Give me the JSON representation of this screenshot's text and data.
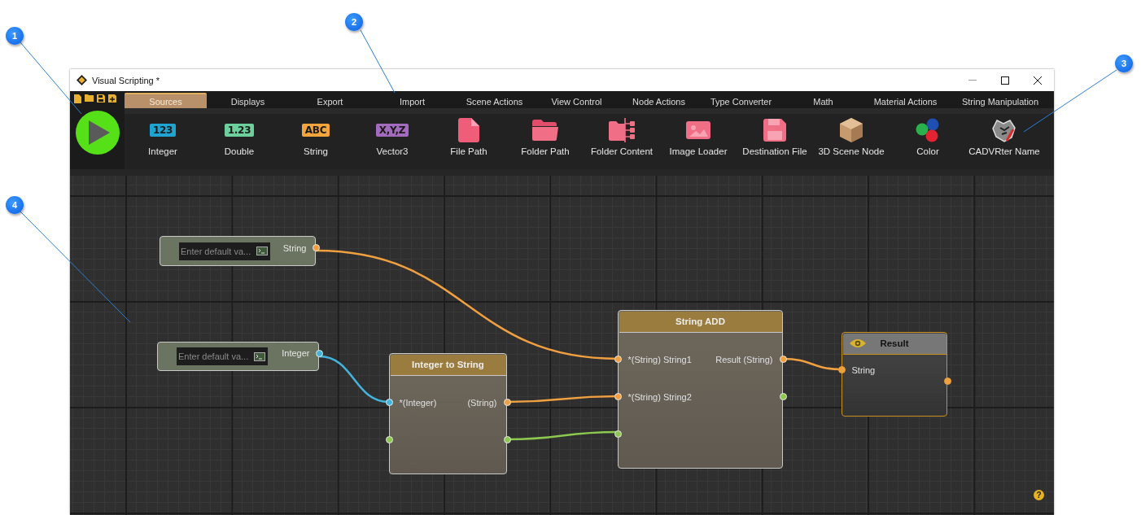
{
  "window": {
    "title": "Visual Scripting *"
  },
  "callouts": [
    {
      "label": "1"
    },
    {
      "label": "2"
    },
    {
      "label": "3"
    },
    {
      "label": "4"
    }
  ],
  "tabs": [
    {
      "label": "Sources",
      "selected": true
    },
    {
      "label": "Displays",
      "selected": false
    },
    {
      "label": "Export",
      "selected": false
    },
    {
      "label": "Import",
      "selected": false
    },
    {
      "label": "Scene Actions",
      "selected": false
    },
    {
      "label": "View Control",
      "selected": false
    },
    {
      "label": "Node Actions",
      "selected": false
    },
    {
      "label": "Type Converter",
      "selected": false
    },
    {
      "label": "Math",
      "selected": false
    },
    {
      "label": "Material Actions",
      "selected": false
    },
    {
      "label": "String Manipulation",
      "selected": false
    }
  ],
  "palette": [
    {
      "kind": "badge",
      "badge": "123",
      "color": "#1fa3d1",
      "label": "Integer"
    },
    {
      "kind": "badge",
      "badge": "1.23",
      "color": "#6ccf9c",
      "label": "Double"
    },
    {
      "kind": "badge",
      "badge": "ABC",
      "color": "#f3a43b",
      "label": "String"
    },
    {
      "kind": "badge",
      "badge": "X,Y,Z",
      "color": "#a26bbd",
      "label": "Vector3"
    },
    {
      "kind": "file",
      "label": "File Path"
    },
    {
      "kind": "folder",
      "label": "Folder Path"
    },
    {
      "kind": "folder-content",
      "label": "Folder Content"
    },
    {
      "kind": "image",
      "label": "Image Loader"
    },
    {
      "kind": "floppy",
      "label": "Destination File"
    },
    {
      "kind": "cube",
      "label": "3D Scene Node"
    },
    {
      "kind": "color",
      "label": "Color"
    },
    {
      "kind": "logo",
      "label": "CADVRter Name"
    }
  ],
  "nodes": [
    {
      "kind": "source",
      "placeholder": "Enter default va...",
      "output": {
        "label": "String",
        "color": "#f0a040"
      }
    },
    {
      "kind": "source",
      "placeholder": "Enter default va...",
      "output": {
        "label": "Integer",
        "color": "#43b5dc"
      }
    },
    {
      "kind": "function",
      "title": "Integer to String",
      "rows": [
        {
          "left": {
            "label": "*(Integer)",
            "color": "#43b5dc"
          },
          "right": {
            "label": "(String)",
            "color": "#f0a040"
          }
        },
        {
          "left": {
            "color": "#8dc850"
          },
          "right": {
            "color": "#8dc850"
          }
        }
      ]
    },
    {
      "kind": "function",
      "title": "String ADD",
      "rows": [
        {
          "left": {
            "label": "*(String) String1",
            "color": "#f0a040"
          },
          "right": {
            "label": "Result (String)",
            "color": "#f0a040"
          }
        },
        {
          "left": {
            "label": "*(String) String2",
            "color": "#f0a040"
          },
          "right": {
            "color": "#8dc850"
          }
        },
        {
          "left": {
            "color": "#8dc850"
          }
        }
      ]
    },
    {
      "kind": "display",
      "title": "Result",
      "rows": [
        {
          "left": {
            "label": "String",
            "color": "#f0a040"
          }
        },
        {
          "right": {
            "color": "#f0a040"
          }
        }
      ]
    }
  ],
  "wires": [
    {
      "color": "#f0a040"
    },
    {
      "color": "#43b5dc"
    },
    {
      "color": "#f0a040"
    },
    {
      "color": "#8dc850"
    },
    {
      "color": "#f0a040"
    }
  ],
  "help": "?"
}
